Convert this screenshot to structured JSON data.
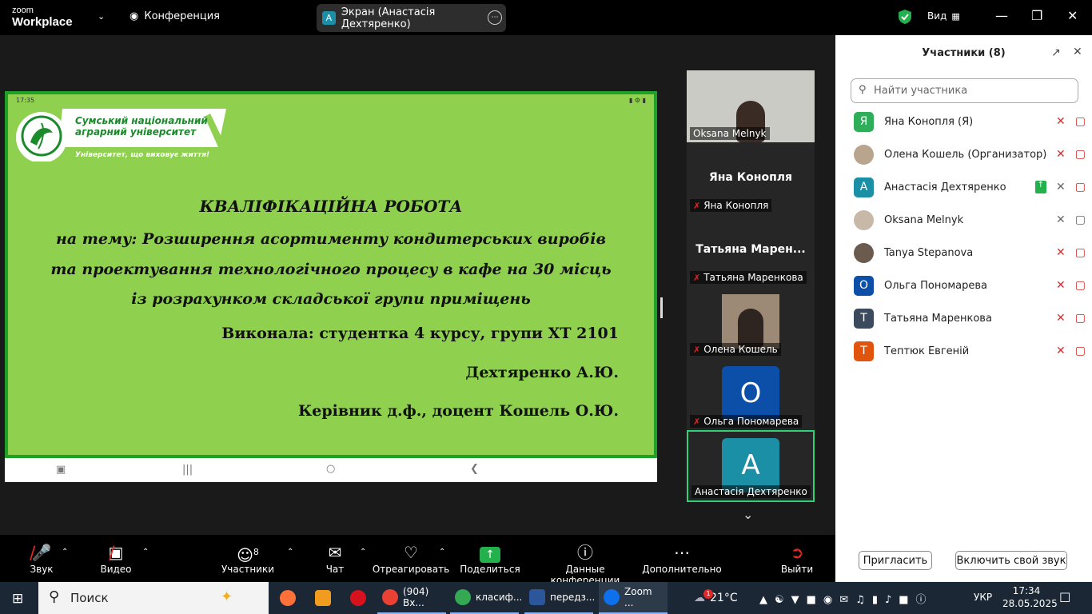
{
  "topbar": {
    "logo_line1": "zoom",
    "logo_line2": "Workplace",
    "conference_label": "Конференция",
    "screen_share_initial": "А",
    "screen_share_label": "Экран (Анастасія Дехтяренко)",
    "view_label": "Вид"
  },
  "slide": {
    "phone_time": "17:35",
    "university_name_line1": "Сумський національний",
    "university_name_line2": "аграрний університет",
    "university_motto": "Університет, що виховує життя!",
    "title": "КВАЛІФІКАЦІЙНА РОБОТА",
    "topic_line1": "на тему: Розширення асортименту кондитерських виробів",
    "topic_line2": "та проектування технологічного процесу в кафе на 30 місць",
    "topic_line3": "із розрахунком складської групи приміщень",
    "author_line": "Виконала: студентка 4 курсу, групи ХТ 2101",
    "author_name": "Дехтяренко А.Ю.",
    "supervisor_line": "Керівник д.ф., доцент Кошель О.Ю."
  },
  "gallery": {
    "tile1_name": "Oksana Melnyk",
    "tile2_bigname": "Яна Конопля",
    "tile2_name": "Яна Конопля",
    "tile3_bigname": "Татьяна  Марен...",
    "tile3_name": "Татьяна Маренкова",
    "tile4_name": "Олена Кошель",
    "tile5_initial": "О",
    "tile5_name": "Ольга Пономарева",
    "tile6_initial": "А",
    "tile6_name": "Анастасія Дехтяренко"
  },
  "participants": {
    "title": "Участники (8)",
    "search_placeholder": "Найти участника",
    "list": [
      {
        "initial": "Я",
        "name": "Яна Конопля (Я)",
        "color": "#2fae5a"
      },
      {
        "initial": "",
        "name": "Олена Кошель (Организатор)",
        "color": "#b9a48d"
      },
      {
        "initial": "А",
        "name": "Анастасія Дехтяренко",
        "color": "#1b8fa6"
      },
      {
        "initial": "",
        "name": "Oksana Melnyk",
        "color": "#c8b8a8"
      },
      {
        "initial": "",
        "name": "Tanya Stepanova",
        "color": "#6b5a4e"
      },
      {
        "initial": "О",
        "name": "Ольга Пономарева",
        "color": "#0b4fa8"
      },
      {
        "initial": "Т",
        "name": "Татьяна Маренкова",
        "color": "#3b4a5c"
      },
      {
        "initial": "Т",
        "name": "Тептюк Евгеній",
        "color": "#e0540d"
      }
    ],
    "invite_button": "Пригласить",
    "unmute_button": "Включить свой звук"
  },
  "toolbar": {
    "audio": "Звук",
    "video": "Видео",
    "participants": "Участники",
    "participants_count": "8",
    "chat": "Чат",
    "react": "Отреагировать",
    "share": "Поделиться",
    "info": "Данные конференции",
    "more": "Дополнительно",
    "leave": "Выйти"
  },
  "taskbar": {
    "search": "Поиск",
    "app1": "(904) Вх...",
    "app2": "класиф...",
    "app3": "передз...",
    "app4": "Zoom ...",
    "weather": "21°C",
    "lang": "УКР",
    "time": "17:34",
    "date": "28.05.2025",
    "notif_badge": "1"
  }
}
